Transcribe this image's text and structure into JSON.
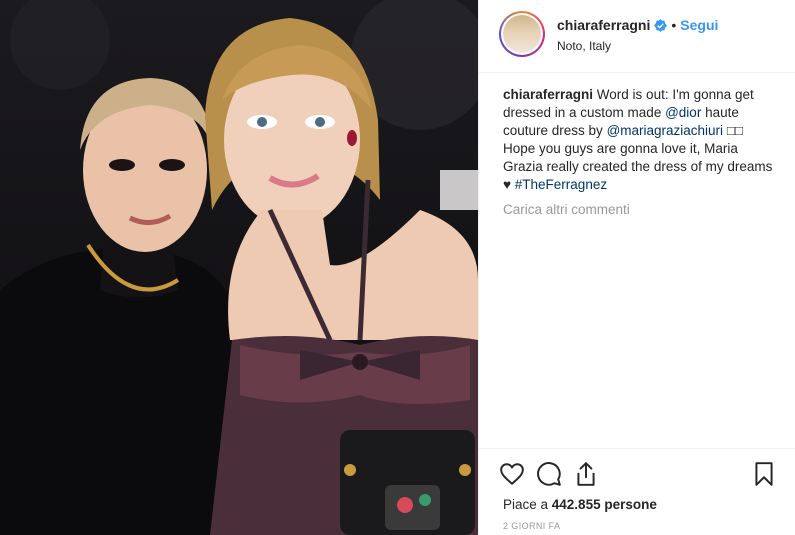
{
  "post": {
    "username": "chiaraferragni",
    "verified": true,
    "follow_label": "Segui",
    "separator": "•",
    "location": "Noto, Italy"
  },
  "caption": {
    "user": "chiaraferragni",
    "text_1": " Word is out: I'm gonna get dressed in a custom made ",
    "mention_1": "@dior",
    "text_2": " haute couture dress by ",
    "mention_2": "@mariagraziachiuri",
    "text_3": " □□ Hope you guys are gonna love it, Maria Grazia really created the dress of my dreams ♥ ",
    "hashtag": "#TheFerragnez"
  },
  "load_more_label": "Carica altri commenti",
  "likes": {
    "prefix": "Piace a ",
    "count": "442.855",
    "suffix": " persone"
  },
  "time_ago": "2 GIORNI FA",
  "icons": {
    "like": "heart-icon",
    "comment": "comment-icon",
    "share": "share-icon",
    "save": "bookmark-icon",
    "verified": "verified-badge-icon"
  },
  "colors": {
    "link": "#3897f0",
    "hashtag": "#003569",
    "muted": "#999999",
    "text": "#262626"
  }
}
